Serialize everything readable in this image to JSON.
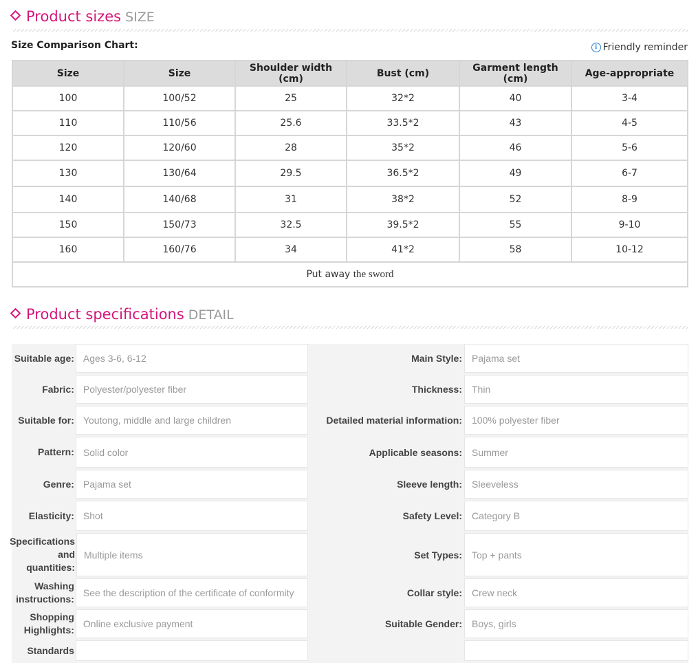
{
  "sizes_section": {
    "title": "Product sizes",
    "subtitle": "SIZE"
  },
  "chart_label": "Size Comparison Chart:",
  "reminder": "Friendly reminder",
  "size_table": {
    "headers": [
      "Size",
      "Size",
      "Shoulder width (cm)",
      "Bust (cm)",
      "Garment length (cm)",
      "Age-appropriate"
    ],
    "rows": [
      [
        "100",
        "100/52",
        "25",
        "32*2",
        "40",
        "3-4"
      ],
      [
        "110",
        "110/56",
        "25.6",
        "33.5*2",
        "43",
        "4-5"
      ],
      [
        "120",
        "120/60",
        "28",
        "35*2",
        "46",
        "5-6"
      ],
      [
        "130",
        "130/64",
        "29.5",
        "36.5*2",
        "49",
        "6-7"
      ],
      [
        "140",
        "140/68",
        "31",
        "38*2",
        "52",
        "8-9"
      ],
      [
        "150",
        "150/73",
        "32.5",
        "39.5*2",
        "55",
        "9-10"
      ],
      [
        "160",
        "160/76",
        "34",
        "41*2",
        "58",
        "10-12"
      ]
    ],
    "footer_a": "Put away",
    "footer_b": "the  sword"
  },
  "spec_section": {
    "title": "Product specifications",
    "subtitle": "DETAIL"
  },
  "specs": [
    {
      "l1": "Suitable age:",
      "v1": "Ages 3-6, 6-12",
      "l2": "Main Style:",
      "v2": "Pajama set"
    },
    {
      "l1": "Fabric:",
      "v1": "Polyester/polyester fiber",
      "l2": "Thickness:",
      "v2": "Thin"
    },
    {
      "l1": "Suitable for:",
      "v1": "Youtong, middle and large children",
      "l2": "Detailed material information:",
      "v2": "100% polyester fiber"
    },
    {
      "l1": "Pattern:",
      "v1": "Solid color",
      "l2": "Applicable seasons:",
      "v2": "Summer"
    },
    {
      "l1": "Genre:",
      "v1": "Pajama set",
      "l2": "Sleeve length:",
      "v2": "Sleeveless"
    },
    {
      "l1": "Elasticity:",
      "v1": "Shot",
      "l2": "Safety Level:",
      "v2": "Category B"
    },
    {
      "l1": "Specifications and quantities:",
      "v1": "Multiple items",
      "l2": "Set Types:",
      "v2": "Top + pants"
    },
    {
      "l1": "Washing instructions:",
      "v1": "See the description of the certificate of conformity",
      "l2": "Collar style:",
      "v2": "Crew neck"
    },
    {
      "l1": "Shopping Highlights:",
      "v1": "Online exclusive payment",
      "l2": "Suitable Gender:",
      "v2": "Boys, girls"
    },
    {
      "l1": "Standards",
      "v1": "",
      "l2": "",
      "v2": ""
    }
  ],
  "colors": {
    "accent": "#d4147a",
    "subtitle": "#999999",
    "table_header": "#dcdcdc"
  }
}
